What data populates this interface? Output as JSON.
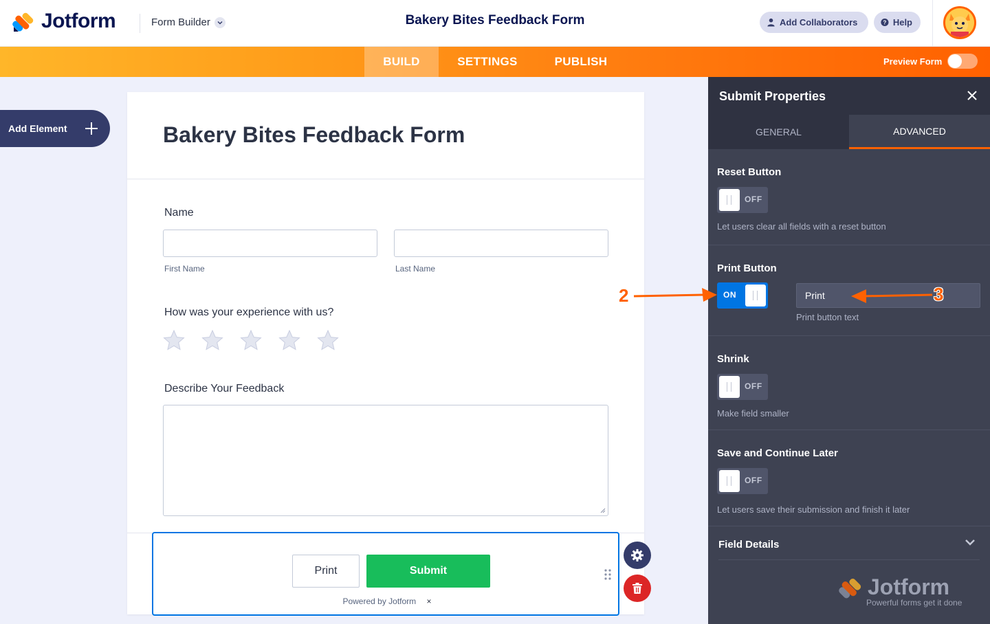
{
  "header": {
    "logo_text": "Jotform",
    "builder_dropdown": "Form Builder",
    "form_title": "Bakery Bites Feedback Form",
    "add_collaborators": "Add Collaborators",
    "help": "Help"
  },
  "nav": {
    "tabs": [
      "BUILD",
      "SETTINGS",
      "PUBLISH"
    ],
    "active_tab": "BUILD",
    "preview_label": "Preview Form",
    "preview_on": false
  },
  "sidebar": {
    "add_element": "Add Element"
  },
  "form": {
    "title": "Bakery Bites Feedback Form",
    "name_label": "Name",
    "first_name_sub": "First Name",
    "last_name_sub": "Last Name",
    "rating_label": "How was your experience with us?",
    "rating_stars": 5,
    "feedback_label": "Describe Your Feedback",
    "print_button": "Print",
    "submit_button": "Submit",
    "powered_by": "Powered by Jotform",
    "powered_close": "×"
  },
  "panel": {
    "title": "Submit Properties",
    "tabs": [
      "GENERAL",
      "ADVANCED"
    ],
    "active_tab": "ADVANCED",
    "sections": {
      "reset": {
        "title": "Reset Button",
        "state": "OFF",
        "desc": "Let users clear all fields with a reset button"
      },
      "print": {
        "title": "Print Button",
        "state": "ON",
        "text_value": "Print",
        "text_desc": "Print button text"
      },
      "shrink": {
        "title": "Shrink",
        "state": "OFF",
        "desc": "Make field smaller"
      },
      "save": {
        "title": "Save and Continue Later",
        "state": "OFF",
        "desc": "Let users save their submission and finish it later"
      },
      "details": {
        "title": "Field Details"
      }
    },
    "watermark": {
      "logo": "Jotform",
      "tagline": "Powerful forms get it done"
    }
  },
  "annotations": {
    "step2": "2",
    "step3": "3"
  },
  "colors": {
    "brand_orange": "#ff6100",
    "navy": "#0a1551",
    "toggle_on": "#0075e3",
    "submit_green": "#18bd5b",
    "delete_red": "#dc2626"
  }
}
